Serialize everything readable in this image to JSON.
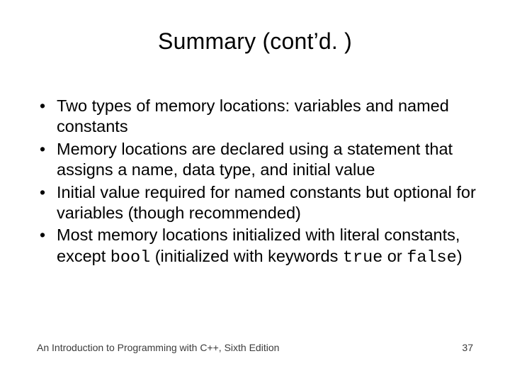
{
  "title": "Summary (cont’d. )",
  "bullets": {
    "b0": "Two types of memory locations: variables and named constants",
    "b1": "Memory locations are declared using a statement that assigns a name, data type, and initial value",
    "b2": "Initial value required for named constants but optional for variables (though recommended)",
    "b3_part1": "Most memory locations initialized with literal constants, except ",
    "b3_code1": "bool",
    "b3_part2": " (initialized with keywords ",
    "b3_code2": "true",
    "b3_part3": " or ",
    "b3_code3": "false",
    "b3_part4": ")"
  },
  "footer": {
    "left": "An Introduction to Programming with C++, Sixth Edition",
    "right": "37"
  }
}
